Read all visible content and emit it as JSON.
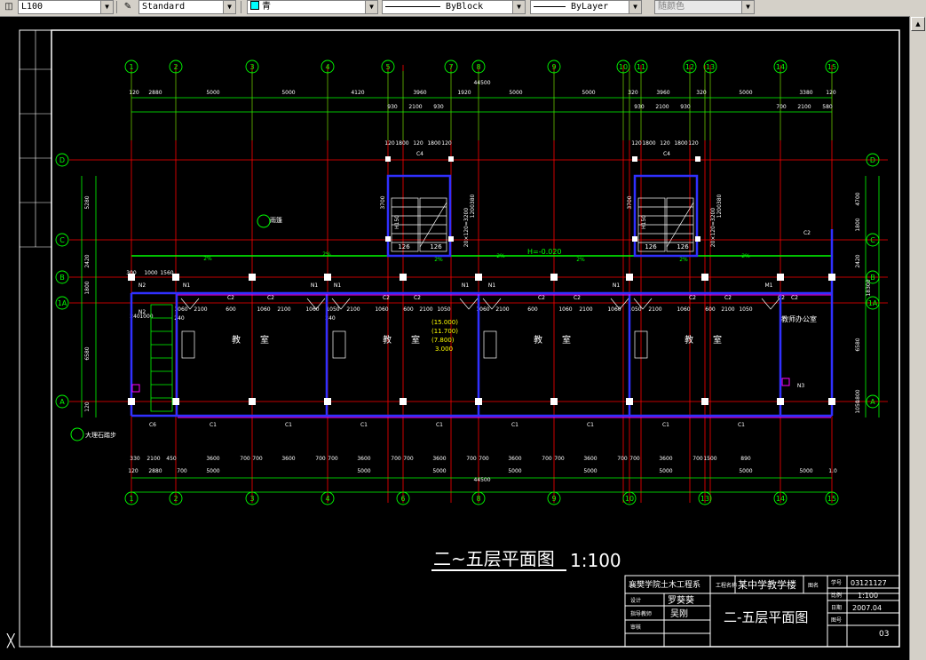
{
  "toolbar": {
    "layer_value": "L100",
    "text_style_value": "Standard",
    "color_value": "青",
    "linetype_value": "ByBlock",
    "lineweight_value": "ByLayer",
    "plotstyle_value": "随颜色"
  },
  "drawing": {
    "axes_top": [
      "1",
      "2",
      "3",
      "4",
      "5",
      "7",
      "8",
      "9",
      "10",
      "11",
      "12",
      "13",
      "14",
      "15"
    ],
    "axes_bottom": [
      "1",
      "2",
      "3",
      "4",
      "6",
      "8",
      "9",
      "10",
      "13",
      "14",
      "15"
    ],
    "axes_rows": [
      "D",
      "C",
      "B",
      "1A",
      "A"
    ],
    "dim_total_top": "44500",
    "dim_total_bottom": "44500",
    "dim_row1": [
      "120",
      "2880",
      "5000",
      "5000",
      "4120",
      "3960",
      "1920",
      "5000",
      "5000",
      "320",
      "3960",
      "320",
      "5000",
      "3380",
      "120"
    ],
    "dim_row2_left": [
      "930",
      "2100",
      "930"
    ],
    "dim_row2_right": [
      "930",
      "2100",
      "930"
    ],
    "dim_row2_far": [
      "700",
      "2100",
      "580"
    ],
    "stair_dims": [
      "120",
      "1800",
      "120",
      "1800",
      "120"
    ],
    "stair_labels": [
      "C4",
      "C4",
      "126",
      "126",
      "126",
      "126"
    ],
    "stair_side": [
      "3700",
      "H150",
      "1200380",
      "20×120=3200"
    ],
    "left_dims": [
      "5280",
      "2420",
      "1800",
      "6580",
      "120"
    ],
    "right_dims": [
      "4700",
      "1800",
      "2420",
      "18300",
      "6580",
      "1050",
      "1800"
    ],
    "corridor_level": "H=-0.020",
    "elevations": [
      "(15.000)",
      "(11.700)",
      "(7.800)",
      "3.000"
    ],
    "room_labels": [
      "教",
      "室",
      "教",
      "室",
      "教",
      "室",
      "教",
      "室"
    ],
    "office_label": "教师办公室",
    "doors": [
      "N1",
      "N1",
      "N1",
      "N1",
      "N1",
      "N1",
      "M1",
      "N2",
      "N2",
      "N3",
      "C2",
      "C1",
      "C1",
      "C1",
      "C1",
      "C1",
      "C1",
      "C1",
      "C1",
      "C6",
      "C2",
      "C2",
      "C2",
      "C2",
      "C2",
      "C2",
      "C2",
      "C2",
      "C2",
      "C2"
    ],
    "window_dims": [
      "1060",
      "2100",
      "600",
      "1060",
      "2100",
      "1060",
      "1050",
      "2100",
      "1060",
      "600",
      "2100",
      "1050"
    ],
    "bottom_dim_row1": [
      "330",
      "2100",
      "450",
      "3600",
      "700",
      "700",
      "3600",
      "700",
      "700",
      "3600",
      "700",
      "700",
      "3600",
      "700",
      "700",
      "3600",
      "700",
      "700",
      "3600",
      "700",
      "700",
      "3600",
      "700",
      "1500",
      "890"
    ],
    "bottom_dim_row2": [
      "120",
      "2880",
      "700",
      "5000",
      "5000",
      "5000",
      "5000",
      "5000",
      "5000",
      "5000",
      "5000",
      "1.0"
    ],
    "left_note": "大理石踏步",
    "left_dims2": [
      "300",
      "1000",
      "1560",
      "240",
      "1000",
      "240",
      "240"
    ],
    "slope": "2%",
    "callout": "雨篷",
    "title": "二~五层平面图",
    "scale": "1:100"
  },
  "title_block": {
    "school": "襄樊学院土木工程系",
    "project_label": "工程名称",
    "project": "某中学教学楼",
    "drawing_label": "图名",
    "designer_label": "设计",
    "designer": "罗葵葵",
    "reviewer_label": "指导教师",
    "reviewer": "吴刚",
    "checker_label": "审核",
    "drawing_title": "二-五层平面图",
    "no_label": "学号",
    "no": "03121127",
    "scale_label": "比例",
    "scale": "1:100",
    "date_label": "日期",
    "date": "2007.04",
    "sheet_label": "图号",
    "sheet": "03"
  },
  "colors": {
    "grid": "#00ff00",
    "axis": "#ff0000",
    "wall": "#0000ff",
    "text": "#ffffff",
    "dim": "#00ff00",
    "cyan": "#00ffff",
    "magenta": "#ff00ff",
    "yellow": "#ffff00"
  }
}
